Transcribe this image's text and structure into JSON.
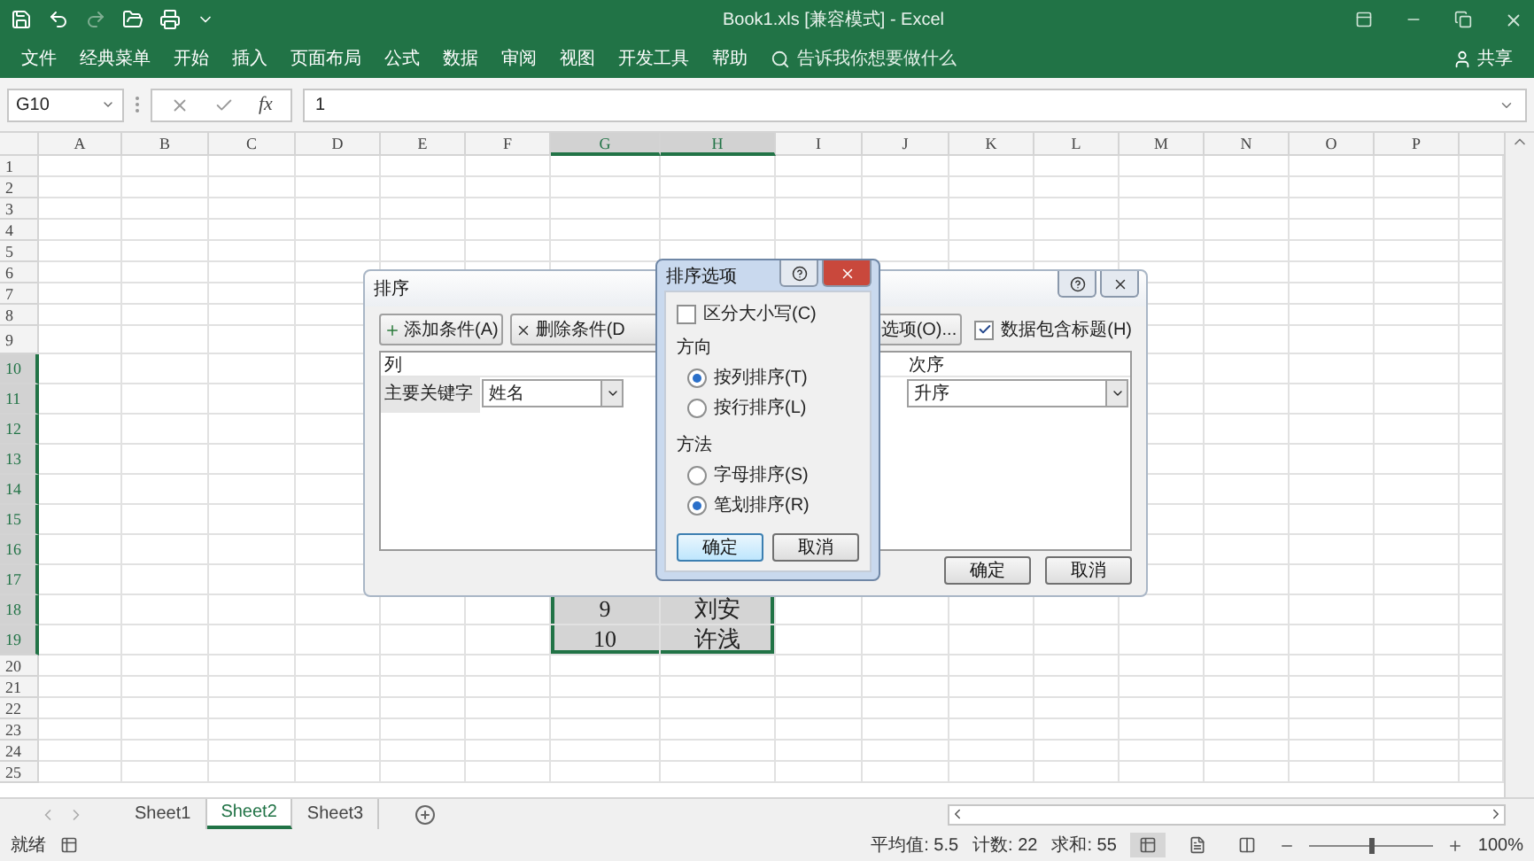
{
  "title_bar": {
    "title": "Book1.xls  [兼容模式]  -  Excel"
  },
  "menu": [
    "文件",
    "经典菜单",
    "开始",
    "插入",
    "页面布局",
    "公式",
    "数据",
    "审阅",
    "视图",
    "开发工具",
    "帮助"
  ],
  "search": {
    "placeholder": "告诉我你想要做什么"
  },
  "share": "共享",
  "formula_bar": {
    "name_box": "G10",
    "function_label": "fx",
    "value": "1"
  },
  "columns": [
    {
      "label": "A",
      "selected": false
    },
    {
      "label": "B",
      "selected": false
    },
    {
      "label": "C",
      "selected": false
    },
    {
      "label": "D",
      "selected": false
    },
    {
      "label": "E",
      "selected": false
    },
    {
      "label": "F",
      "selected": false
    },
    {
      "label": "G",
      "selected": true
    },
    {
      "label": "H",
      "selected": true
    },
    {
      "label": "I",
      "selected": false
    },
    {
      "label": "J",
      "selected": false
    },
    {
      "label": "K",
      "selected": false
    },
    {
      "label": "L",
      "selected": false
    },
    {
      "label": "M",
      "selected": false
    },
    {
      "label": "N",
      "selected": false
    },
    {
      "label": "O",
      "selected": false
    },
    {
      "label": "P",
      "selected": false
    }
  ],
  "rows": [
    {
      "label": "1",
      "selected": false
    },
    {
      "label": "2",
      "selected": false
    },
    {
      "label": "3",
      "selected": false
    },
    {
      "label": "4",
      "selected": false
    },
    {
      "label": "5",
      "selected": false
    },
    {
      "label": "6",
      "selected": false
    },
    {
      "label": "7",
      "selected": false
    },
    {
      "label": "8",
      "selected": false
    },
    {
      "label": "9",
      "selected": false
    },
    {
      "label": "10",
      "selected": true
    },
    {
      "label": "11",
      "selected": true
    },
    {
      "label": "12",
      "selected": true
    },
    {
      "label": "13",
      "selected": true
    },
    {
      "label": "14",
      "selected": true
    },
    {
      "label": "15",
      "selected": true
    },
    {
      "label": "16",
      "selected": true
    },
    {
      "label": "17",
      "selected": true
    },
    {
      "label": "18",
      "selected": true,
      "cells": [
        "9",
        "刘安"
      ]
    },
    {
      "label": "19",
      "selected": true,
      "cells": [
        "10",
        "许浅"
      ]
    },
    {
      "label": "20",
      "selected": false
    },
    {
      "label": "21",
      "selected": false
    },
    {
      "label": "22",
      "selected": false
    },
    {
      "label": "23",
      "selected": false
    },
    {
      "label": "24",
      "selected": false
    },
    {
      "label": "25",
      "selected": false
    }
  ],
  "sort_dialog": {
    "title": "排序",
    "toolbar": [
      {
        "label": "添加条件(A)",
        "kind": "add"
      },
      {
        "label": "删除条件(D",
        "kind": "delete"
      },
      {
        "label": "选项(O)...",
        "kind": "plain"
      }
    ],
    "header_checkbox": {
      "label": "数据包含标题(H)",
      "checked": true
    },
    "columns": [
      "列",
      "次序"
    ],
    "rows": [
      {
        "label": "主要关键字",
        "column": "姓名",
        "order": "升序"
      }
    ],
    "buttons": [
      "确定",
      "取消"
    ]
  },
  "options_dialog": {
    "title": "排序选项",
    "case_sensitive": {
      "label": "区分大小写(C)",
      "checked": false
    },
    "groups": [
      {
        "title": "方向",
        "options": [
          {
            "label": "按列排序(T)",
            "selected": true
          },
          {
            "label": "按行排序(L)",
            "selected": false
          }
        ]
      },
      {
        "title": "方法",
        "options": [
          {
            "label": "字母排序(S)",
            "selected": false
          },
          {
            "label": "笔划排序(R)",
            "selected": true
          }
        ]
      }
    ],
    "buttons": [
      {
        "label": "确定",
        "focused": true
      },
      {
        "label": "取消",
        "focused": false
      }
    ]
  },
  "sheets": [
    {
      "label": "Sheet1",
      "selected": false
    },
    {
      "label": "Sheet2",
      "selected": true
    },
    {
      "label": "Sheet3",
      "selected": false
    }
  ],
  "status_bar": {
    "ready": "就绪",
    "stats": [
      "平均值: 5.5",
      "计数: 22",
      "求和: 55"
    ],
    "zoom": {
      "level": 0.5
    },
    "zoom_label": "100%"
  }
}
